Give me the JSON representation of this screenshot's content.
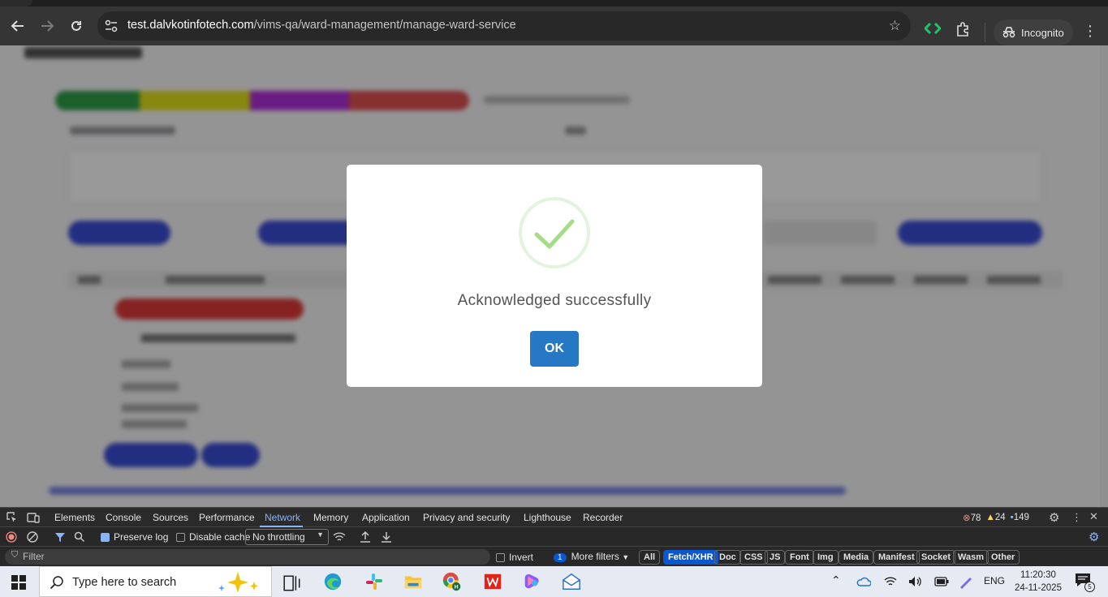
{
  "browser": {
    "url_host": "test.dalvkotinfotech.com",
    "url_path": "/vims-qa/ward-management/manage-ward-service",
    "incognito_label": "Incognito"
  },
  "modal": {
    "message": "Acknowledged successfully",
    "ok_label": "OK",
    "accent_color": "#2778c4",
    "check_color": "#a5dc86"
  },
  "devtools": {
    "tabs": [
      "Elements",
      "Console",
      "Sources",
      "Performance",
      "Network",
      "Memory",
      "Application",
      "Privacy and security",
      "Lighthouse",
      "Recorder"
    ],
    "active_tab": "Network",
    "errors": "78",
    "warnings": "24",
    "messages": "149",
    "preserve_log": "Preserve log",
    "disable_cache": "Disable cache",
    "throttling": "No throttling",
    "filter_placeholder": "Filter",
    "invert": "Invert",
    "more_filters_count": "1",
    "more_filters": "More filters",
    "type_filters": [
      "All",
      "Fetch/XHR",
      "Doc",
      "CSS",
      "JS",
      "Font",
      "Img",
      "Media",
      "Manifest",
      "Socket",
      "Wasm",
      "Other"
    ],
    "active_type_filter": "Fetch/XHR"
  },
  "taskbar": {
    "search_placeholder": "Type here to search",
    "language": "ENG",
    "time": "11:20:30",
    "date": "24-11-2025",
    "notification_count": "5"
  }
}
